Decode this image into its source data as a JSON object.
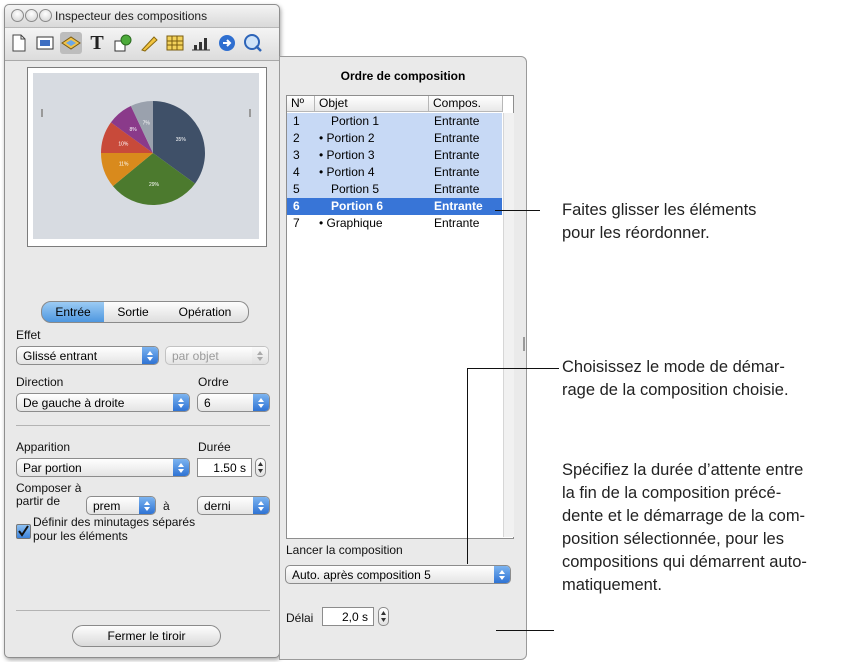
{
  "window": {
    "title": "Inspecteur des compositions"
  },
  "toolbar": {
    "icons": [
      "document-icon",
      "slide-icon",
      "build-icon",
      "text-icon",
      "graphic-icon",
      "metrics-icon",
      "table-icon",
      "chart-icon",
      "hyperlink-icon",
      "quicktime-icon"
    ],
    "selected_index": 2
  },
  "preview": {
    "pie_labels": [
      "35%",
      "29%",
      "11%",
      "10%",
      "8%",
      "7%"
    ],
    "pie_values": [
      35,
      29,
      11,
      10,
      8,
      7
    ],
    "pie_colors": [
      "#3f5068",
      "#4c7a2e",
      "#d98a1c",
      "#c84a3a",
      "#8a3a8a",
      "#9aa1ad"
    ]
  },
  "tabs": [
    {
      "label": "Entrée",
      "active": true
    },
    {
      "label": "Sortie",
      "active": false
    },
    {
      "label": "Opération",
      "active": false
    }
  ],
  "effect": {
    "label": "Effet",
    "value": "Glissé entrant",
    "secondary": "par objet"
  },
  "direction": {
    "label": "Direction",
    "value": "De gauche à droite"
  },
  "order": {
    "label": "Ordre",
    "value": "6"
  },
  "appearance": {
    "label": "Apparition",
    "value": "Par portion"
  },
  "duration": {
    "label": "Durée",
    "value": "1.50 s"
  },
  "compose": {
    "label_line1": "Composer à",
    "label_line2": "partir de",
    "from": "prem",
    "to_label": "à",
    "to": "derni"
  },
  "separate_timing": {
    "checked": true,
    "line1": "Définir des minutages séparés",
    "line2": "pour les éléments"
  },
  "close_drawer": "Fermer le tiroir",
  "drawer": {
    "title": "Ordre de composition",
    "columns": [
      "Nº",
      "Objet",
      "Compos."
    ],
    "rows": [
      {
        "n": "1",
        "obj": "Portion 1",
        "comp": "Entrante"
      },
      {
        "n": "2",
        "obj": "• Portion 2",
        "comp": "Entrante"
      },
      {
        "n": "3",
        "obj": "• Portion 3",
        "comp": "Entrante"
      },
      {
        "n": "4",
        "obj": "• Portion 4",
        "comp": "Entrante"
      },
      {
        "n": "5",
        "obj": "Portion 5",
        "comp": "Entrante"
      },
      {
        "n": "6",
        "obj": "Portion 6",
        "comp": "Entrante"
      },
      {
        "n": "7",
        "obj": "• Graphique",
        "comp": "Entrante"
      }
    ],
    "selected_row": 6,
    "start_label": "Lancer la composition",
    "start_value": "Auto. après composition 5",
    "delay_label": "Délai",
    "delay_value": "2,0 s"
  },
  "callouts": [
    {
      "line1": "Faites glisser les éléments",
      "line2": "pour les réordonner."
    },
    {
      "line1": "Choisissez le mode de démar-",
      "line2": "rage de la composition choisie."
    },
    {
      "line1": "Spécifiez la durée d’attente entre",
      "line2": "la fin de la composition précé-",
      "line3": "dente et le démarrage de la com-",
      "line4": "position sélectionnée, pour les",
      "line5": "compositions qui démarrent auto-",
      "line6": "matiquement."
    }
  ]
}
